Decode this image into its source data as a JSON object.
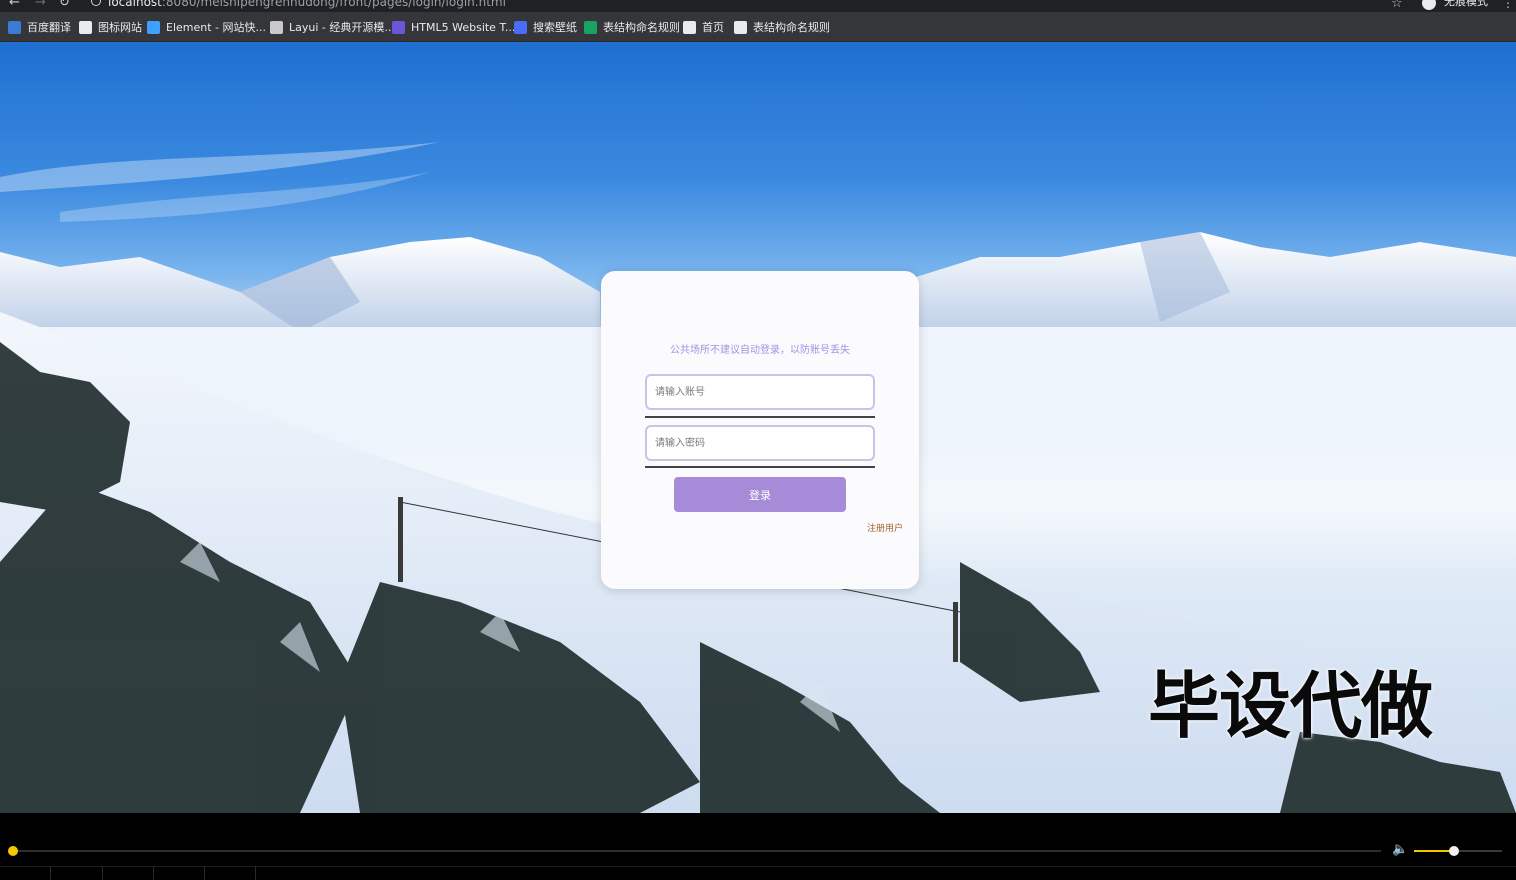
{
  "browser": {
    "url_host": "localhost",
    "url_rest": ":8080/meishipengrenhudong/front/pages/login/login.html",
    "incognito_label": "无痕模式",
    "bookmarks": [
      {
        "label": "百度翻译",
        "color": "#3a7bd5"
      },
      {
        "label": "图标网站",
        "color": "#e8eaed"
      },
      {
        "label": "Element - 网站快...",
        "color": "#409eff"
      },
      {
        "label": "Layui - 经典开源模...",
        "color": "#c9c9c9"
      },
      {
        "label": "HTML5 Website T...",
        "color": "#6c55d9"
      },
      {
        "label": "搜索壁纸",
        "color": "#4a6cf7"
      },
      {
        "label": "表结构命名规则",
        "color": "#1aa260"
      },
      {
        "label": "首页",
        "color": "#e8eaed"
      },
      {
        "label": "表结构命名规则",
        "color": "#e8eaed"
      }
    ]
  },
  "login": {
    "tip": "公共场所不建议自动登录，以防账号丢失",
    "account_placeholder": "请输入账号",
    "password_placeholder": "请输入密码",
    "submit_label": "登录",
    "register_label": "注册用户"
  },
  "watermark": "毕设代做",
  "player": {
    "progress": 0.0,
    "volume": 0.45,
    "accent_color": "#f6c700"
  }
}
